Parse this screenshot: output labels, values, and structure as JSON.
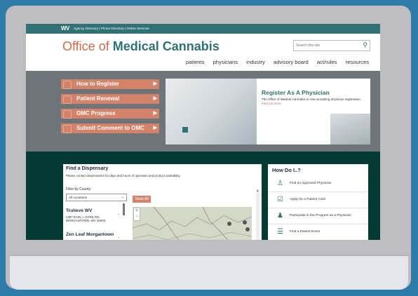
{
  "topbar": {
    "logo": "WV",
    "links": "Agency Directory | Phone Directory | Online Services"
  },
  "header": {
    "brand_prefix": "Office of ",
    "brand_main": "Medical Cannabis",
    "search_placeholder": "Search this site",
    "nav": [
      "patients",
      "physicians",
      "industry",
      "advisory board",
      "act/rules",
      "resources"
    ]
  },
  "hero": {
    "buttons": [
      "How to Register",
      "Patient Renewal",
      "OMC Progress",
      "Submit Comment to OMC"
    ],
    "slide_title": "Register As A Physician",
    "slide_text": "The Office of Medical Cannabis is now accepting physician registration",
    "slide_link": "Find out more."
  },
  "dispensary": {
    "title": "Find a Dispensary",
    "subtitle": "Please contact dispensaries for days and hours of operation and product availability.",
    "filter_label": "Filter by County:",
    "county_value": "All Locations",
    "show_all": "Show All",
    "items": [
      {
        "name": "Trulieve WV",
        "addr1": "1397 EARL L CORE RD,",
        "addr2": "MORGANTOWN, WV 26505"
      },
      {
        "name": "Zen Leaf Morgantown"
      }
    ]
  },
  "howdo": {
    "title": "How Do I..?",
    "items": [
      {
        "label": "Find an Approved Physician",
        "icon": "physician-icon"
      },
      {
        "label": "Apply for a Patient Card",
        "icon": "checkbox-icon"
      },
      {
        "label": "Participate in the Program as a Physician",
        "icon": "people-icon"
      },
      {
        "label": "Find a Patient Event",
        "icon": "list-icon"
      }
    ]
  },
  "colors": {
    "teal": "#2f7175",
    "salmon": "#d5826a",
    "dark_green": "#053a34",
    "hero_gray": "#6e7579"
  }
}
